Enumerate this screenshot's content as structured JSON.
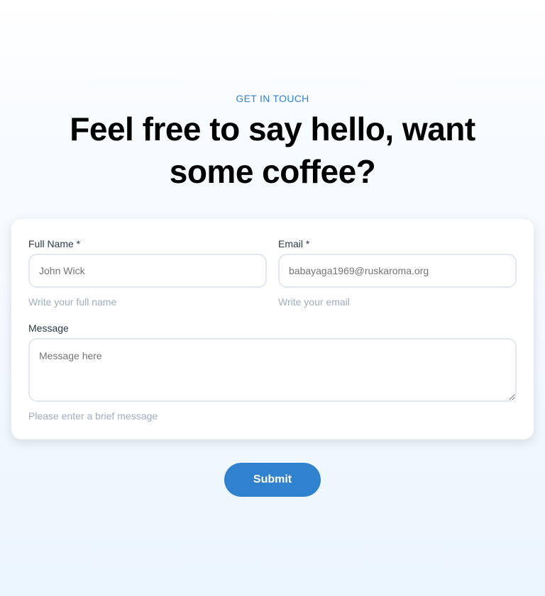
{
  "header": {
    "eyebrow": "GET IN TOUCH",
    "title": "Feel free to say hello, want some coffee?"
  },
  "form": {
    "full_name": {
      "label": "Full Name *",
      "placeholder": "John Wick",
      "help": "Write your full name"
    },
    "email": {
      "label": "Email *",
      "placeholder": "babayaga1969@ruskaroma.org",
      "help": "Write your email"
    },
    "message": {
      "label": "Message",
      "placeholder": "Message here",
      "help": "Please enter a brief message"
    },
    "submit_label": "Submit"
  },
  "colors": {
    "accent": "#3182ce"
  }
}
